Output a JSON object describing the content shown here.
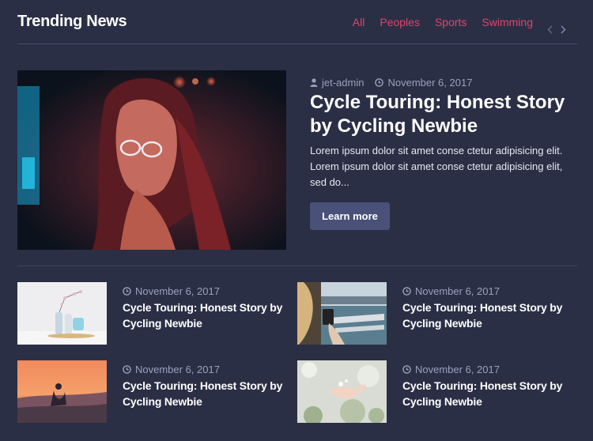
{
  "header": {
    "title": "Trending News",
    "filters": [
      "All",
      "Peoples",
      "Sports",
      "Swimming"
    ],
    "prev_icon": "chevron-left-icon",
    "next_icon": "chevron-right-icon"
  },
  "featured": {
    "author": "jet-admin",
    "date": "November 6, 2017",
    "title": "Cycle Touring: Honest Story by Cycling Newbie",
    "excerpt": "Lorem ipsum dolor sit amet conse ctetur adipisicing elit. Lorem ipsum dolor sit amet conse ctetur adipisicing elit, sed do...",
    "button": "Learn more",
    "author_icon": "user-icon",
    "date_icon": "clock-icon"
  },
  "cards": [
    {
      "date": "November 6, 2017",
      "title": "Cycle Touring: Honest Story by Cycling Newbie"
    },
    {
      "date": "November 6, 2017",
      "title": "Cycle Touring: Honest Story by Cycling Newbie"
    },
    {
      "date": "November 6, 2017",
      "title": "Cycle Touring: Honest Story by Cycling Newbie"
    },
    {
      "date": "November 6, 2017",
      "title": "Cycle Touring: Honest Story by Cycling Newbie"
    }
  ],
  "colors": {
    "background": "#2b2f45",
    "accent": "#e0436b",
    "button": "#4a5178",
    "meta": "#9aa0bd"
  }
}
